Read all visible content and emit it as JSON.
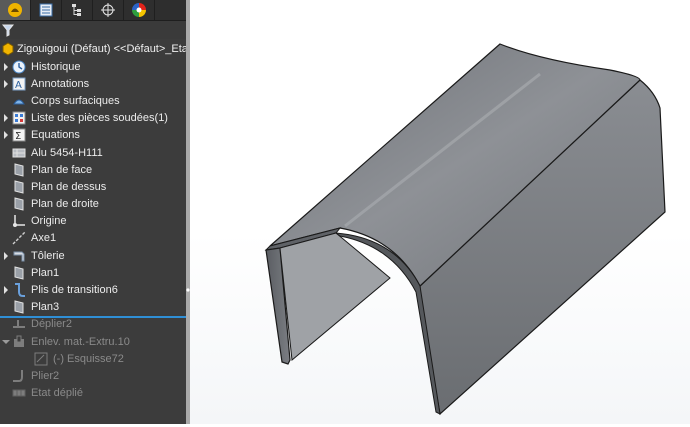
{
  "panel": {
    "tabs": [
      {
        "name": "featuremanager-tab",
        "icon": "feature-tree-icon",
        "active": true
      },
      {
        "name": "propertymanager-tab",
        "icon": "property-list-icon",
        "active": false
      },
      {
        "name": "configurationmanager-tab",
        "icon": "configuration-icon",
        "active": false
      },
      {
        "name": "dimxpert-tab",
        "icon": "crosshair-icon",
        "active": false
      },
      {
        "name": "displaymanager-tab",
        "icon": "color-wheel-icon",
        "active": false
      }
    ],
    "root_label": "Zigouigoui (Défaut) <<Défaut>_Etat d'af",
    "tree": [
      {
        "label": "Historique",
        "icon": "history-icon",
        "expander": true,
        "dim": false
      },
      {
        "label": "Annotations",
        "icon": "annotation-icon",
        "expander": true,
        "dim": false
      },
      {
        "label": "Corps surfaciques",
        "icon": "surface-bodies-icon",
        "expander": false,
        "dim": false
      },
      {
        "label": "Liste des pièces soudées(1)",
        "icon": "cut-list-icon",
        "expander": true,
        "dim": false
      },
      {
        "label": "Equations",
        "icon": "sigma-icon",
        "expander": true,
        "dim": false
      },
      {
        "label": "Alu 5454-H111",
        "icon": "material-icon",
        "expander": false,
        "dim": false
      },
      {
        "label": "Plan de face",
        "icon": "plane-icon",
        "expander": false,
        "dim": false
      },
      {
        "label": "Plan de dessus",
        "icon": "plane-icon",
        "expander": false,
        "dim": false
      },
      {
        "label": "Plan de droite",
        "icon": "plane-icon",
        "expander": false,
        "dim": false
      },
      {
        "label": "Origine",
        "icon": "origin-icon",
        "expander": false,
        "dim": false
      },
      {
        "label": "Axe1",
        "icon": "axis-icon",
        "expander": false,
        "dim": false
      },
      {
        "label": "Tôlerie",
        "icon": "sheet-metal-icon",
        "expander": true,
        "dim": false
      },
      {
        "label": "Plan1",
        "icon": "plane-icon",
        "expander": false,
        "dim": false
      },
      {
        "label": "Plis de transition6",
        "icon": "lofted-bend-icon",
        "expander": true,
        "dim": false
      },
      {
        "label": "Plan3",
        "icon": "plane-icon",
        "expander": false,
        "dim": false
      },
      {
        "label": "Déplier2",
        "icon": "unfold-icon",
        "expander": false,
        "dim": true
      },
      {
        "label": "Enlev. mat.-Extru.10",
        "icon": "extruded-cut-icon",
        "expander": true,
        "dim": true,
        "expanded": true
      },
      {
        "label": "(-) Esquisse72",
        "icon": "sketch-icon",
        "expander": false,
        "dim": true,
        "indent": true
      },
      {
        "label": "Plier2",
        "icon": "fold-icon",
        "expander": false,
        "dim": true
      },
      {
        "label": "Etat déplié",
        "icon": "flat-pattern-icon",
        "expander": false,
        "dim": true
      }
    ]
  },
  "colors": {
    "panel_bg": "#3c3c3c",
    "rollback_bar": "#2f8fd6",
    "model_fill": "#8a8d91",
    "model_edge": "#1a1a1a"
  }
}
